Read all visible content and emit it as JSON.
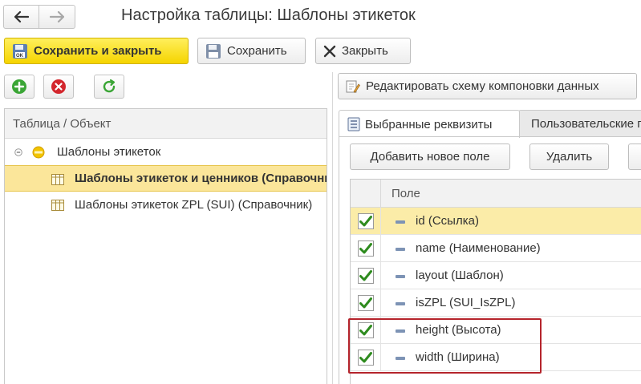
{
  "window": {
    "title": "Настройка таблицы: Шаблоны этикеток"
  },
  "toolbar": {
    "save_close_label": "Сохранить и закрыть",
    "save_label": "Сохранить",
    "close_label": "Закрыть"
  },
  "left_panel": {
    "column_header": "Таблица / Объект",
    "tree": [
      {
        "label": "Шаблоны этикеток",
        "level": 0,
        "selected": false
      },
      {
        "label": "Шаблоны этикеток и ценников (Справочник)",
        "level": 1,
        "selected": true
      },
      {
        "label": "Шаблоны этикеток ZPL (SUI) (Справочник)",
        "level": 1,
        "selected": false
      }
    ]
  },
  "right_panel": {
    "edit_schema_label": "Редактировать схему компоновки данных",
    "tabs": [
      {
        "label": "Выбранные реквизиты",
        "active": true
      },
      {
        "label": "Пользовательские поля",
        "active": false
      }
    ],
    "add_field_label": "Добавить новое поле",
    "delete_label": "Удалить",
    "grid": {
      "column_header": "Поле",
      "rows": [
        {
          "label": "id (Ссылка)",
          "checked": true,
          "selected": true
        },
        {
          "label": "name (Наименование)",
          "checked": true,
          "selected": false
        },
        {
          "label": "layout (Шаблон)",
          "checked": true,
          "selected": false
        },
        {
          "label": "isZPL (SUI_IsZPL)",
          "checked": true,
          "selected": false
        },
        {
          "label": "height (Высота)",
          "checked": true,
          "selected": false
        },
        {
          "label": "width (Ширина)",
          "checked": true,
          "selected": false
        }
      ]
    }
  },
  "colors": {
    "primary_button": "#f5d400",
    "selection": "#fbe69a",
    "checkmark": "#2e8b1e",
    "highlight_border": "#b5242c",
    "add_icon": "#3aa535",
    "delete_icon": "#d3262d",
    "refresh_icon": "#3aa535"
  },
  "icons": {
    "back": "arrow-left-icon",
    "forward": "arrow-right-icon",
    "save_close": "floppy-ok-icon",
    "save": "floppy-icon",
    "close": "x-icon",
    "add": "plus-circle-icon",
    "delete": "x-circle-icon",
    "refresh": "refresh-icon",
    "edit_schema": "pencil-sheet-icon",
    "tab_selected": "list-icon",
    "tab_custom": "fx-icon",
    "tree_collapse": "minus-small-icon",
    "tree_root": "yellow-circle-icon",
    "tree_table": "table-icon",
    "field": "dash-icon",
    "check": "checkmark-icon"
  }
}
